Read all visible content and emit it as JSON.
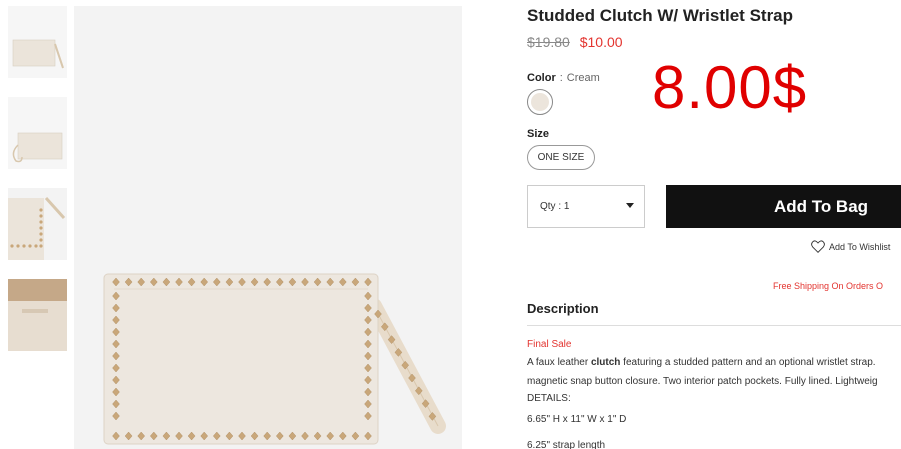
{
  "product": {
    "title": "Studded Clutch W/ Wristlet Strap",
    "original_price": "$19.80",
    "sale_price": "$10.00",
    "overlay_price": "8.00$"
  },
  "color": {
    "label": "Color",
    "separator": ":",
    "value": "Cream",
    "swatch_hex": "#ece5dc"
  },
  "size": {
    "label": "Size",
    "options": [
      "ONE SIZE"
    ]
  },
  "quantity": {
    "label": "Qty : 1"
  },
  "actions": {
    "add_to_bag": "Add To Bag",
    "wishlist": "Add To Wishlist"
  },
  "shipping": {
    "text": "Free Shipping On Orders O"
  },
  "description": {
    "heading": "Description",
    "final_sale": "Final Sale",
    "line1_pre": "A faux leather ",
    "line1_bold": "clutch",
    "line1_post": " featuring a studded pattern and an optional wristlet strap.",
    "line2": "magnetic snap button closure. Two interior patch pockets. Fully lined. Lightweig",
    "details_label": "DETAILS:",
    "dimensions": "6.65\" H x 11\" W x 1\" D",
    "strap_length": "6.25\" strap length"
  },
  "colors": {
    "accent_red": "#e3342f",
    "button_black": "#111111",
    "product_cream": "#ede7df",
    "stud_gold": "#c9a77a"
  },
  "thumbnails": [
    {
      "name": "thumbnail-1-icon"
    },
    {
      "name": "thumbnail-2-icon"
    },
    {
      "name": "thumbnail-3-icon"
    },
    {
      "name": "thumbnail-4-icon"
    }
  ]
}
